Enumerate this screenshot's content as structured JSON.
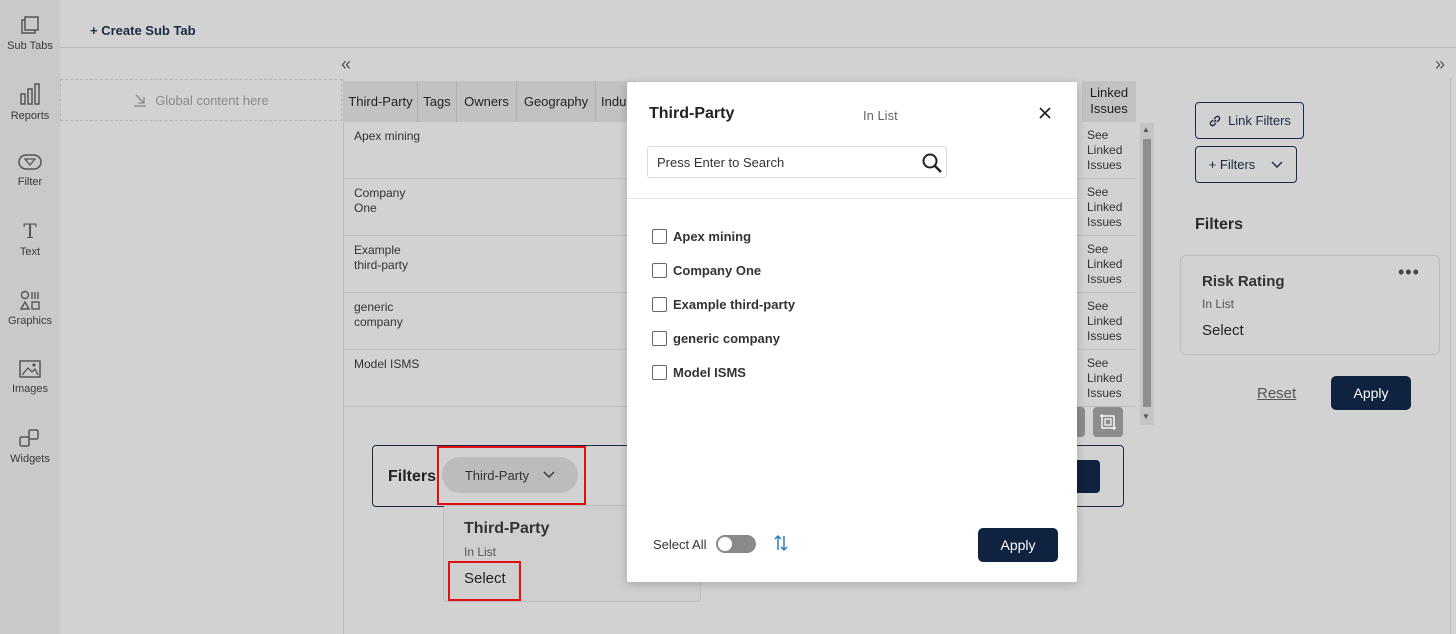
{
  "rail": {
    "items": [
      {
        "label": "Sub Tabs",
        "icon": "sub-tabs-icon"
      },
      {
        "label": "Reports",
        "icon": "bar-chart-icon"
      },
      {
        "label": "Filter",
        "icon": "filter-icon"
      },
      {
        "label": "Text",
        "icon": "text-icon"
      },
      {
        "label": "Graphics",
        "icon": "shapes-icon"
      },
      {
        "label": "Images",
        "icon": "image-icon"
      },
      {
        "label": "Widgets",
        "icon": "widgets-icon"
      }
    ]
  },
  "topbar": {
    "create_sub_tab": "+ Create Sub Tab",
    "collapse_left": "«",
    "expand_right": "»"
  },
  "global": {
    "placeholder": "Global content here"
  },
  "table": {
    "headers": [
      "Third-Party",
      "Tags",
      "Owners",
      "Geography",
      "Indu"
    ],
    "linked_header": "Linked Issues",
    "rows": [
      {
        "name": "Apex mining",
        "linked": "See Linked Issues"
      },
      {
        "name": "Company One",
        "linked": "See Linked Issues"
      },
      {
        "name": "Example third-party",
        "linked": "See Linked Issues"
      },
      {
        "name": "generic company",
        "linked": "See Linked Issues"
      },
      {
        "name": "Model ISMS",
        "linked": "See Linked Issues"
      }
    ]
  },
  "filters_bar": {
    "label": "Filters",
    "chip_label": "Third-Party"
  },
  "dropdown_card": {
    "title": "Third-Party",
    "subtitle": "In List",
    "select": "Select"
  },
  "right_panel": {
    "link_filters": "Link Filters",
    "add_filters": "+ Filters",
    "filters_title": "Filters",
    "risk_card": {
      "title": "Risk Rating",
      "subtitle": "In List",
      "select": "Select",
      "menu": "•••"
    },
    "reset": "Reset",
    "apply": "Apply"
  },
  "modal": {
    "title": "Third-Party",
    "subtitle": "In List",
    "search_placeholder": "Press Enter to Search",
    "options": [
      {
        "label": "Apex mining",
        "checked": false
      },
      {
        "label": "Company One",
        "checked": false
      },
      {
        "label": "Example third-party",
        "checked": false
      },
      {
        "label": "generic company",
        "checked": false
      },
      {
        "label": "Model ISMS",
        "checked": false
      }
    ],
    "select_all": "Select All",
    "select_all_on": false,
    "apply": "Apply"
  },
  "colors": {
    "navy": "#0f2240",
    "highlight_red": "#e01010",
    "sort_icon_blue": "#2a7fc0"
  }
}
